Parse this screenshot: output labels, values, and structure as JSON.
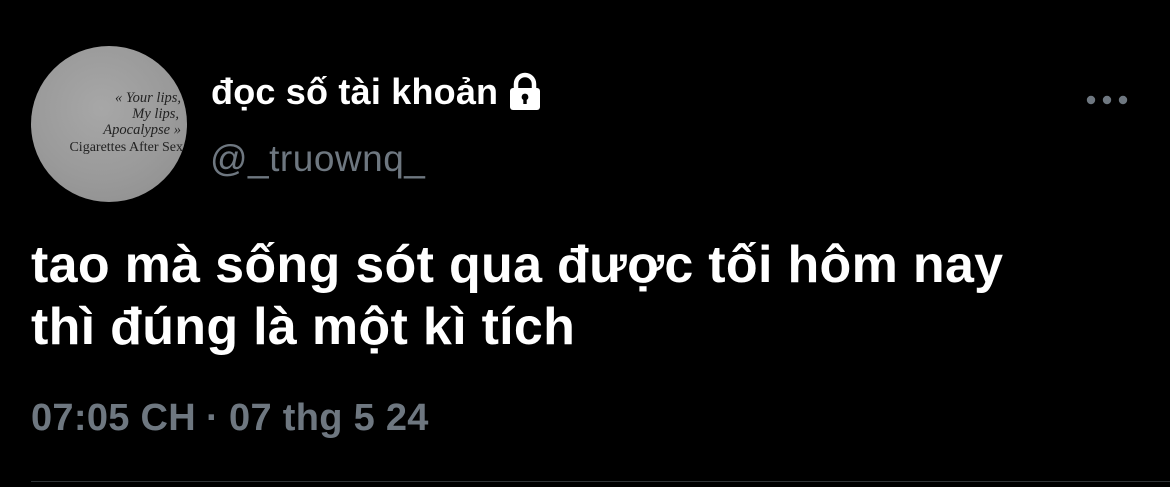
{
  "avatar": {
    "lines": [
      "« Your lips,",
      "My lips,",
      "Apocalypse »",
      "Cigarettes After Sex"
    ]
  },
  "user": {
    "display_name": "đọc số tài khoản",
    "handle": "@_truownq_",
    "protected_icon": "lock-icon"
  },
  "more_icon": "more-horizontal-icon",
  "tweet": {
    "lines": [
      "tao mà sống sót qua được tối hôm nay",
      "thì đúng là một kì tích"
    ]
  },
  "meta": {
    "time": "07:05 CH",
    "separator": "·",
    "date": "07 thg 5 24"
  },
  "colors": {
    "background": "#000000",
    "primary_text": "#ffffff",
    "secondary_text": "#6e7780",
    "avatar_bg": "#9a9a9a"
  }
}
